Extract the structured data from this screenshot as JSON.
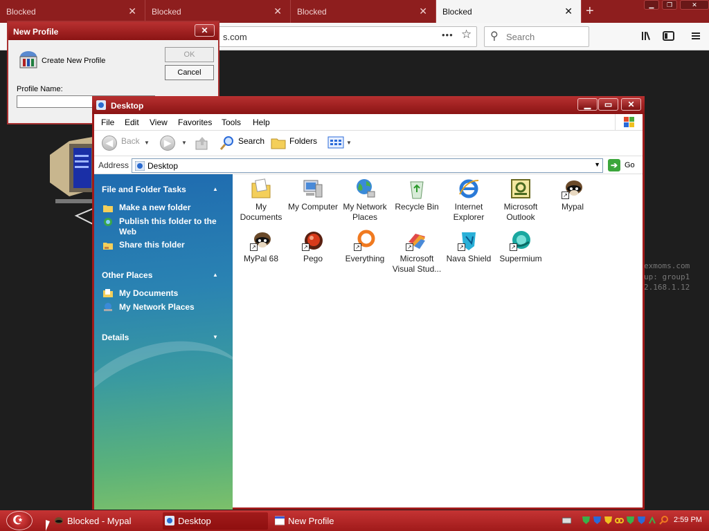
{
  "browser": {
    "tabs": [
      {
        "label": "Blocked",
        "close": "✕"
      },
      {
        "label": "Blocked",
        "close": "✕"
      },
      {
        "label": "Blocked",
        "close": "✕"
      },
      {
        "label": "Blocked",
        "close": "✕"
      }
    ],
    "url_text": "s.com",
    "search_placeholder": "Search",
    "background_text": [
      "exmoms.com",
      "up: group1",
      "2.168.1.12"
    ]
  },
  "new_profile": {
    "title": "New Profile",
    "create_label": "Create New Profile",
    "ok_label": "OK",
    "cancel_label": "Cancel",
    "name_label": "Profile Name:",
    "name_value": ""
  },
  "explorer": {
    "title": "Desktop",
    "menu": [
      "File",
      "Edit",
      "View",
      "Favorites",
      "Tools",
      "Help"
    ],
    "toolbar": {
      "back": "Back",
      "search": "Search",
      "folders": "Folders"
    },
    "address_label": "Address",
    "address_value": "Desktop",
    "go_label": "Go",
    "taskpane": {
      "file_tasks_title": "File and Folder Tasks",
      "file_tasks": [
        "Make a new folder",
        "Publish this folder to the Web",
        "Share this folder"
      ],
      "other_places_title": "Other Places",
      "other_places": [
        "My Documents",
        "My Network Places"
      ],
      "details_title": "Details"
    },
    "icons": [
      {
        "label": "My Documents",
        "icon": "my-documents-icon"
      },
      {
        "label": "My Computer",
        "icon": "my-computer-icon"
      },
      {
        "label": "My Network Places",
        "icon": "network-places-icon"
      },
      {
        "label": "Recycle Bin",
        "icon": "recycle-bin-icon"
      },
      {
        "label": "Internet Explorer",
        "icon": "internet-explorer-icon"
      },
      {
        "label": "Microsoft Outlook",
        "icon": "outlook-icon"
      },
      {
        "label": "Mypal",
        "icon": "mypal-icon"
      },
      {
        "label": "MyPal 68",
        "icon": "mypal-68-icon"
      },
      {
        "label": "Pego",
        "icon": "pego-icon"
      },
      {
        "label": "Everything",
        "icon": "everything-icon"
      },
      {
        "label": "Microsoft Visual Stud...",
        "icon": "visual-studio-icon"
      },
      {
        "label": "Nava Shield",
        "icon": "nava-shield-icon"
      },
      {
        "label": "Supermium",
        "icon": "supermium-icon"
      }
    ]
  },
  "taskbar": {
    "items": [
      "Blocked - Mypal",
      "Desktop",
      "New Profile"
    ],
    "clock": "2:59 PM"
  }
}
